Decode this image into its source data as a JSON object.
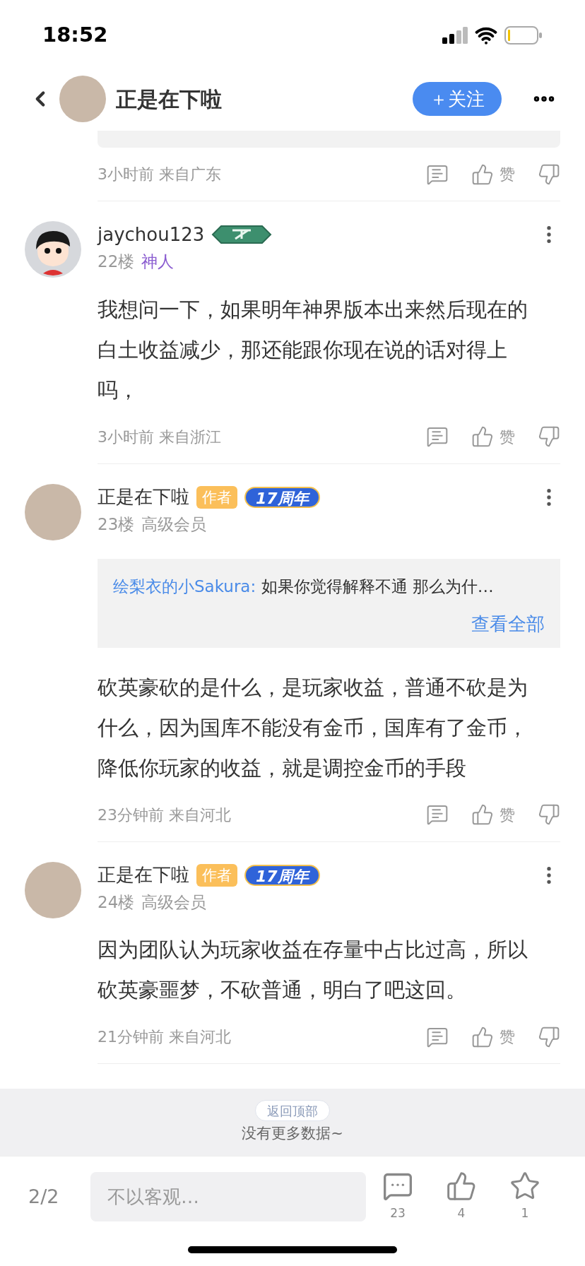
{
  "status_bar": {
    "time": "18:52"
  },
  "header": {
    "username": "正是在下啦",
    "follow_button": "＋关注"
  },
  "comments": [
    {
      "kind": "tail",
      "time": "3小时前 来自广东",
      "like_label": "赞"
    },
    {
      "kind": "full",
      "avatar": {
        "kind": "cartoon"
      },
      "username": "jaychou123",
      "badges": [
        {
          "kind": "level"
        }
      ],
      "floor": "22楼",
      "rank": "神人",
      "color": "#8a5cd0",
      "body": "我想问一下，如果明年神界版本出来然后现在的白土收益减少，那还能跟你现在说的话对得上吗，",
      "time": "3小时前 来自浙江",
      "like_label": "赞"
    },
    {
      "kind": "full",
      "avatar": {
        "kind": "photo"
      },
      "username": "正是在下啦",
      "badges": [
        {
          "kind": "author",
          "text": "作者"
        },
        {
          "kind": "anniversary",
          "text": "17周年"
        }
      ],
      "floor": "23楼",
      "rank": "高级会员",
      "color": "#999999",
      "quote": {
        "author": "绘梨衣的小Sakura:",
        "text": "如果你觉得解释不通 那么为什…",
        "more": "查看全部"
      },
      "body": "砍英豪砍的是什么，是玩家收益，普通不砍是为什么，因为国库不能没有金币，国库有了金币，降低你玩家的收益，就是调控金币的手段",
      "time": "23分钟前 来自河北",
      "like_label": "赞"
    },
    {
      "kind": "full",
      "avatar": {
        "kind": "photo"
      },
      "username": "正是在下啦",
      "badges": [
        {
          "kind": "author",
          "text": "作者"
        },
        {
          "kind": "anniversary",
          "text": "17周年"
        }
      ],
      "floor": "24楼",
      "rank": "高级会员",
      "color": "#999999",
      "body": "因为团队认为玩家收益在存量中占比过高，所以砍英豪噩梦，不砍普通，明白了吧这回。",
      "time": "21分钟前 来自河北",
      "like_label": "赞"
    }
  ],
  "footer": {
    "back_to_top": "返回顶部",
    "message": "没有更多数据~"
  },
  "bottom_bar": {
    "page": "2/2",
    "placeholder": "不以客观…",
    "actions": [
      {
        "kind": "comment",
        "count": "23"
      },
      {
        "kind": "like",
        "count": "4"
      },
      {
        "kind": "star",
        "count": "1"
      }
    ]
  }
}
